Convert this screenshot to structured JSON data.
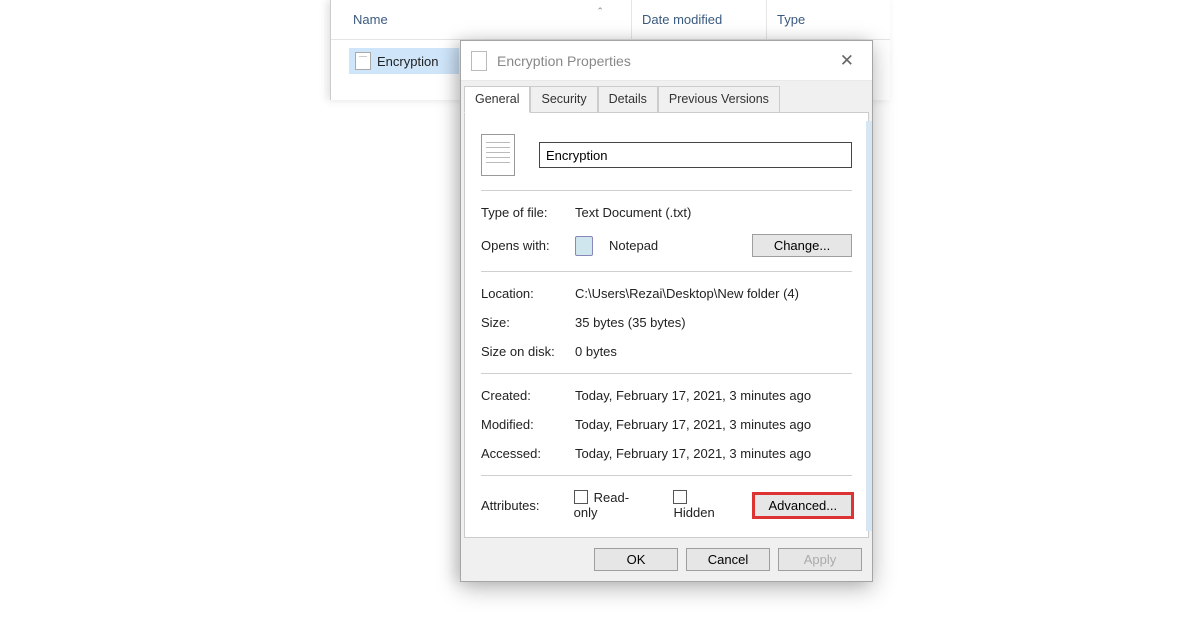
{
  "explorer": {
    "columns": {
      "name": "Name",
      "date": "Date modified",
      "type": "Type"
    },
    "file": "Encryption"
  },
  "dialog": {
    "title": "Encryption Properties",
    "tabs": [
      "General",
      "Security",
      "Details",
      "Previous Versions"
    ],
    "filename": "Encryption",
    "type_label": "Type of file:",
    "type_value": "Text Document (.txt)",
    "opens_label": "Opens with:",
    "opens_value": "Notepad",
    "change_btn": "Change...",
    "location_label": "Location:",
    "location_value": "C:\\Users\\Rezai\\Desktop\\New folder (4)",
    "size_label": "Size:",
    "size_value": "35 bytes (35 bytes)",
    "sizeondisk_label": "Size on disk:",
    "sizeondisk_value": "0 bytes",
    "created_label": "Created:",
    "created_value": "Today, February 17, 2021, 3 minutes ago",
    "modified_label": "Modified:",
    "modified_value": "Today, February 17, 2021, 3 minutes ago",
    "accessed_label": "Accessed:",
    "accessed_value": "Today, February 17, 2021, 3 minutes ago",
    "attributes_label": "Attributes:",
    "readonly_label": "Read-only",
    "hidden_label": "Hidden",
    "advanced_btn": "Advanced...",
    "ok": "OK",
    "cancel": "Cancel",
    "apply": "Apply"
  }
}
